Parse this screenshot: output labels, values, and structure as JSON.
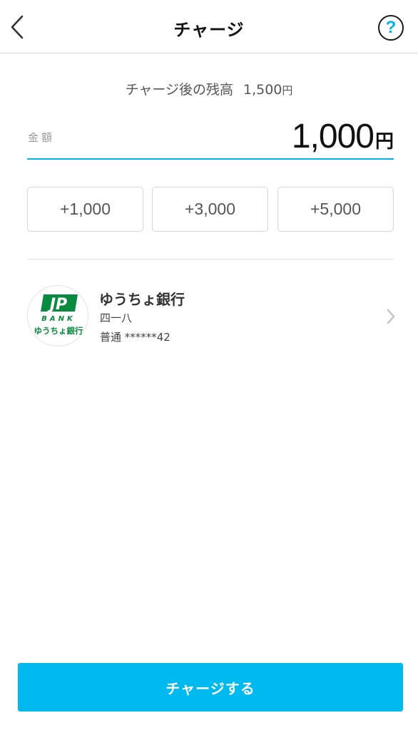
{
  "header": {
    "title": "チャージ",
    "back_icon": "chevron-left-icon",
    "help_icon": "question-circle-icon",
    "help_glyph": "?"
  },
  "balance": {
    "label": "チャージ後の残高",
    "value": "1,500",
    "unit": "円"
  },
  "amount": {
    "label": "金額",
    "value": "1,000",
    "unit": "円"
  },
  "quick_add": [
    {
      "label": "+1,000"
    },
    {
      "label": "+3,000"
    },
    {
      "label": "+5,000"
    }
  ],
  "bank": {
    "logo_text": "JP",
    "logo_sub": "BANK",
    "logo_caption": "ゆうちょ銀行",
    "name": "ゆうちょ銀行",
    "branch": "四一八",
    "account": "普通 ******42"
  },
  "charge_button": {
    "label": "チャージする"
  },
  "colors": {
    "accent": "#00b9ef",
    "jp_bank_green": "#0a8a3e"
  }
}
